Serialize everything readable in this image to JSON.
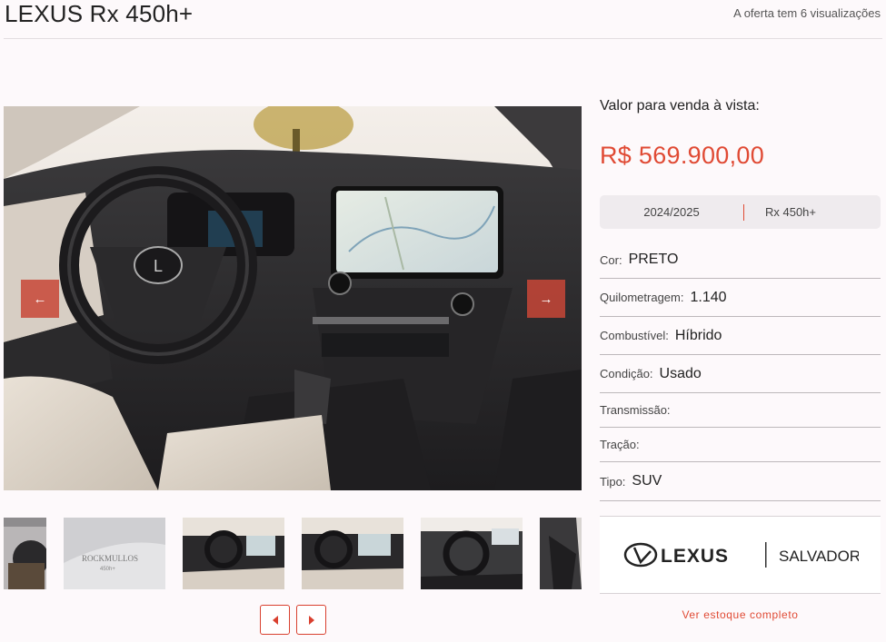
{
  "header": {
    "title": "LEXUS Rx 450h+",
    "views": "A oferta tem 6 visualizações"
  },
  "gallery": {
    "prev_label": "←",
    "next_label": "→",
    "thumbnails": [
      "thumb-1",
      "thumb-2",
      "thumb-3",
      "thumb-4",
      "thumb-5",
      "thumb-6"
    ]
  },
  "pricing": {
    "label": "Valor para venda à vista:",
    "price": "R$ 569.900,00",
    "year": "2024/2025",
    "model": "Rx 450h+"
  },
  "specs": [
    {
      "key": "Cor:",
      "value": "PRETO"
    },
    {
      "key": "Quilometragem:",
      "value": "1.140"
    },
    {
      "key": "Combustível:",
      "value": "Híbrido"
    },
    {
      "key": "Condição:",
      "value": "Usado"
    },
    {
      "key": "Transmissão:",
      "value": ""
    },
    {
      "key": "Tração:",
      "value": ""
    },
    {
      "key": "Tipo:",
      "value": "SUV"
    }
  ],
  "dealer": {
    "brand": "LEXUS",
    "location": "SALVADOR",
    "link": "Ver estoque completo"
  },
  "colors": {
    "accent": "#e04a34",
    "background": "#fdf9fb"
  }
}
